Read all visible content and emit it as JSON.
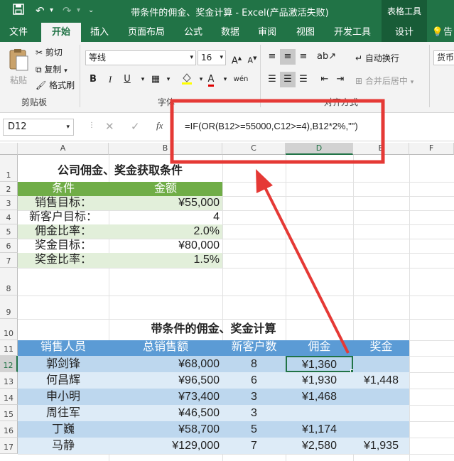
{
  "titlebar": {
    "save_icon": "save-icon",
    "undo_icon": "undo-icon",
    "redo_icon": "redo-icon",
    "title": "带条件的佣金、奖金计算 - Excel(产品激活失败)",
    "context_tab": "表格工具"
  },
  "tabs": [
    "文件",
    "开始",
    "插入",
    "页面布局",
    "公式",
    "数据",
    "审阅",
    "视图",
    "开发工具",
    "设计",
    "告"
  ],
  "ribbon": {
    "clipboard": {
      "paste": "粘贴",
      "cut": "剪切",
      "copy": "复制",
      "format_painter": "格式刷",
      "group_label": "剪贴板"
    },
    "font": {
      "name": "等线",
      "size": "16",
      "grow": "A",
      "shrink": "A",
      "bold": "B",
      "italic": "I",
      "underline": "U",
      "group_label": "字体"
    },
    "alignment": {
      "wrap": "自动换行",
      "merge": "合并后居中",
      "group_label": "对齐方式"
    },
    "number": {
      "format": "货币"
    }
  },
  "formula_bar": {
    "name_box": "D12",
    "fx": "fx",
    "formula": "=IF(OR(B12>=55000,C12>=4),B12*2%,\"\")"
  },
  "columns": [
    "A",
    "B",
    "C",
    "D",
    "E",
    "F"
  ],
  "rows": [
    "1",
    "2",
    "3",
    "4",
    "5",
    "6",
    "7",
    "8",
    "9",
    "10",
    "11",
    "12",
    "13",
    "14",
    "15",
    "16",
    "17"
  ],
  "conditions_table": {
    "title": "公司佣金、奖金获取条件",
    "headers": [
      "条件",
      "金额"
    ],
    "rows": [
      [
        "销售目标：",
        "¥55,000"
      ],
      [
        "新客户目标：",
        "4"
      ],
      [
        "佣金比率：",
        "2.0%"
      ],
      [
        "奖金目标：",
        "¥80,000"
      ],
      [
        "奖金比率：",
        "1.5%"
      ]
    ]
  },
  "calc_table": {
    "title": "带条件的佣金、奖金计算",
    "headers": [
      "销售人员",
      "总销售额",
      "新客户数",
      "佣金",
      "奖金"
    ],
    "rows": [
      [
        "郭剑锋",
        "¥68,000",
        "8",
        "¥1,360",
        ""
      ],
      [
        "何昌辉",
        "¥96,500",
        "6",
        "¥1,930",
        "¥1,448"
      ],
      [
        "申小明",
        "¥73,400",
        "3",
        "¥1,468",
        ""
      ],
      [
        "周往军",
        "¥46,500",
        "3",
        "",
        ""
      ],
      [
        "丁巍",
        "¥58,700",
        "5",
        "¥1,174",
        ""
      ],
      [
        "马静",
        "¥129,000",
        "7",
        "¥2,580",
        "¥1,935"
      ]
    ]
  },
  "highlight_color": "#e53935"
}
